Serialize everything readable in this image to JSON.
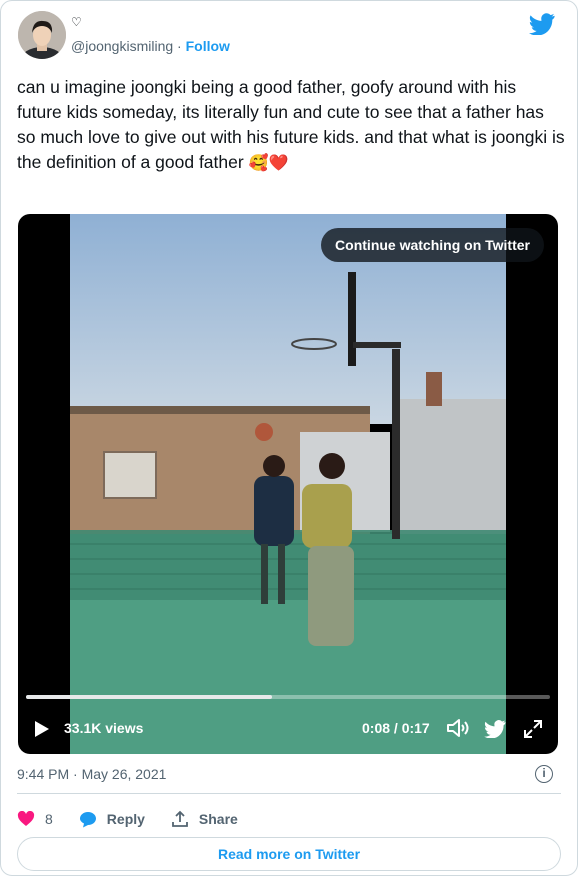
{
  "author": {
    "name_symbol": "♡",
    "handle": "@joongkismiling",
    "separator": " · ",
    "follow_label": "Follow"
  },
  "tweet": {
    "text": "can u imagine joongki being a good father, goofy around with his future kids someday, its literally fun and cute to see that a father has so much love to give out with his future kids. and that what is joongki is the definition of a good father ",
    "emojis": [
      "🥰",
      "❤️"
    ]
  },
  "video": {
    "continue_label": "Continue watching on Twitter",
    "views": "33.1K views",
    "time": "0:08 / 0:17",
    "progress": 0.47
  },
  "meta": {
    "timestamp": "9:44 PM · May 26, 2021",
    "info_icon": "i"
  },
  "actions": {
    "like_count": "8",
    "reply_label": "Reply",
    "share_label": "Share"
  },
  "read_more_label": "Read more on Twitter",
  "colors": {
    "accent": "#1d9bf0",
    "like": "#f91880",
    "text": "#0f1419",
    "secondary": "#536471"
  }
}
